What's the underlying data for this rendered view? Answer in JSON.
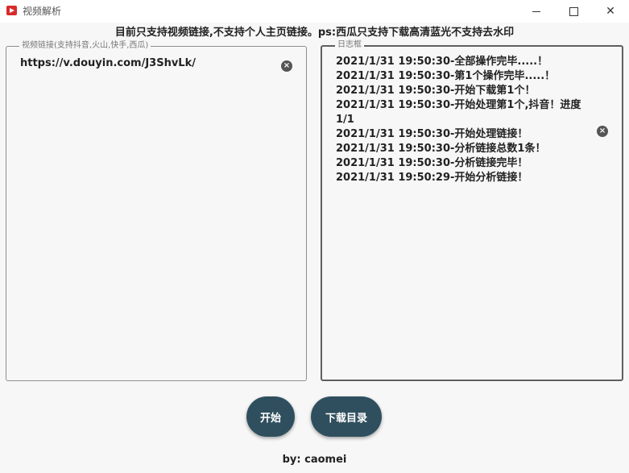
{
  "window": {
    "title": "视频解析",
    "minimize_icon": "minimize-icon",
    "maximize_icon": "maximize-icon",
    "close_label": "✕"
  },
  "notice": "目前只支持视频链接,不支持个人主页链接。ps:西瓜只支持下载高清蓝光不支持去水印",
  "link_panel": {
    "legend": "视频链接(支持抖音,火山,快手,西瓜)",
    "value": "https://v.douyin.com/J3ShvLk/",
    "clear_label": "×"
  },
  "log_panel": {
    "legend": "日志框",
    "clear_label": "×",
    "lines": [
      "2021/1/31 19:50:30-全部操作完毕.....！",
      "2021/1/31 19:50:30-第1个操作完毕.....！",
      "2021/1/31 19:50:30-开始下载第1个！",
      "2021/1/31  19:50:30-开始处理第1个,抖音！进度1/1",
      "2021/1/31 19:50:30-开始处理链接！",
      "2021/1/31 19:50:30-分析链接总数1条！",
      "2021/1/31 19:50:30-分析链接完毕！",
      "2021/1/31 19:50:29-开始分析链接！"
    ]
  },
  "buttons": {
    "start": "开始",
    "download_dir": "下载目录"
  },
  "author": "by: caomei",
  "colors": {
    "button_bg": "#2f4f5e",
    "background": "#f7f7f7",
    "app_icon": "#d62b2b"
  }
}
